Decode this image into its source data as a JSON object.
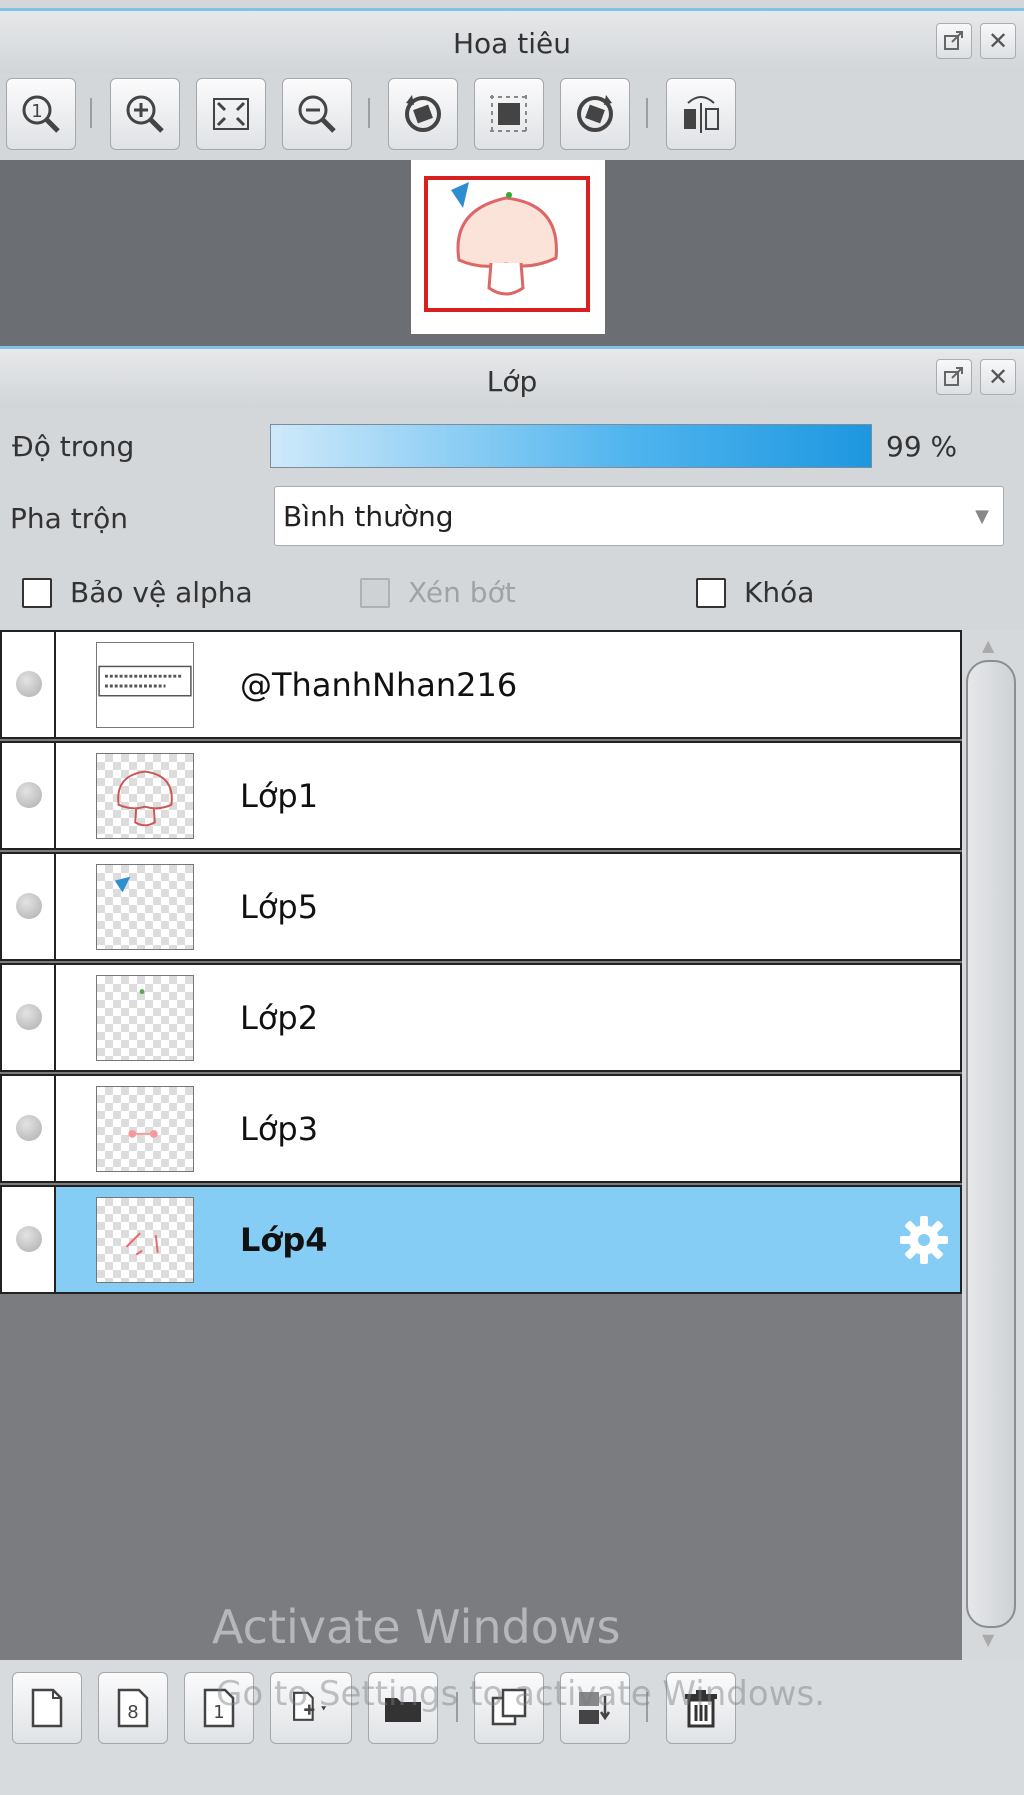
{
  "navigator": {
    "title": "Hoa tiêu",
    "tools": [
      {
        "icon": "zoom-actual-icon"
      },
      {
        "icon": "zoom-in-icon"
      },
      {
        "icon": "fit-screen-icon"
      },
      {
        "icon": "zoom-out-icon"
      },
      {
        "icon": "rotate-left-icon"
      },
      {
        "icon": "reset-view-icon"
      },
      {
        "icon": "rotate-right-icon"
      },
      {
        "icon": "flip-horizontal-icon"
      }
    ]
  },
  "layers_panel": {
    "title": "Lớp",
    "opacity_label": "Độ trong",
    "opacity_value": "99 %",
    "opacity_fraction": 0.99,
    "blend_label": "Pha trộn",
    "blend_value": "Bình thường",
    "protect_alpha_label": "Bảo vệ alpha",
    "clipping_label": "Xén bớt",
    "lock_label": "Khóa",
    "layers": [
      {
        "name": "@ThanhNhan216",
        "selected": false
      },
      {
        "name": "Lớp1",
        "selected": false
      },
      {
        "name": "Lớp5",
        "selected": false
      },
      {
        "name": "Lớp2",
        "selected": false
      },
      {
        "name": "Lớp3",
        "selected": false
      },
      {
        "name": "Lớp4",
        "selected": true
      }
    ]
  },
  "watermark": {
    "line1": "Activate Windows",
    "line2": "Go to Settings to activate Windows."
  },
  "colors": {
    "accent": "#7fc4e8",
    "selected_row": "#85cdf4",
    "list_background": "#7a7c7f"
  }
}
